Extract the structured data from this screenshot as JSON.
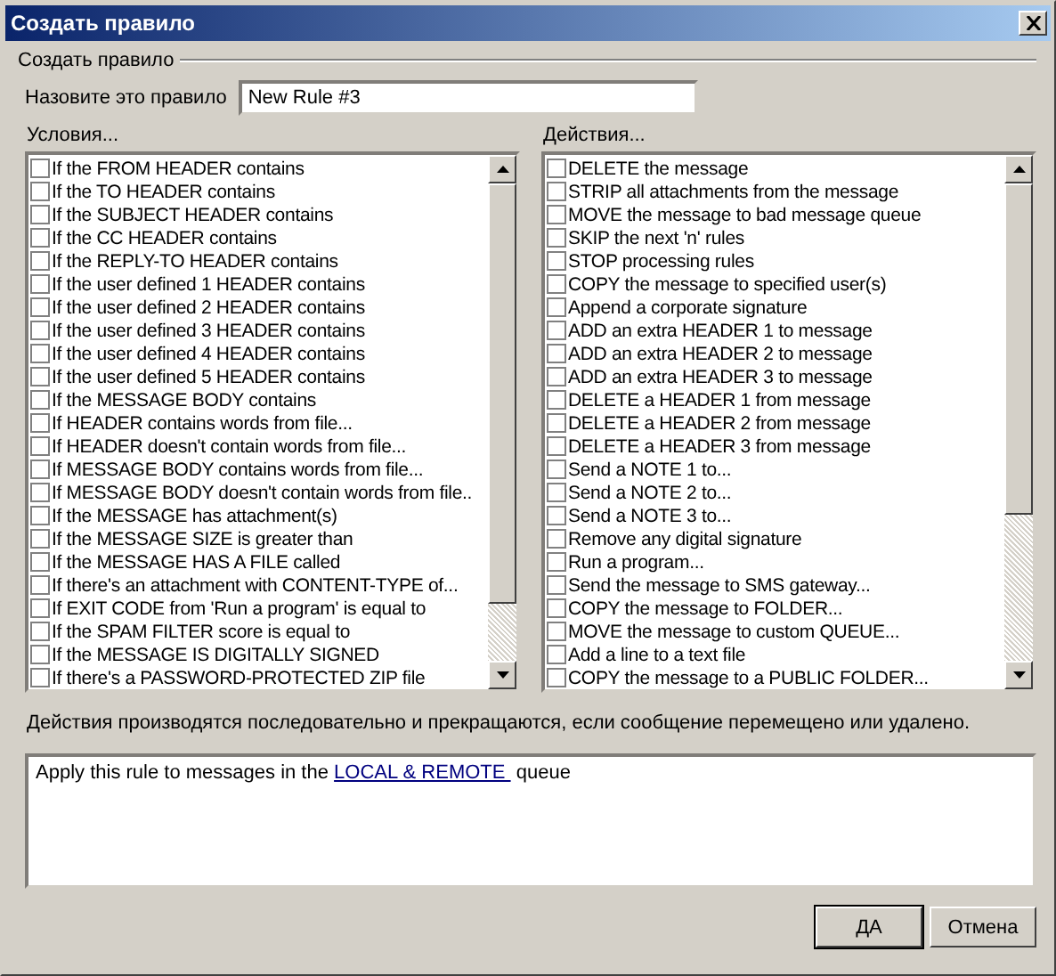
{
  "window": {
    "title": "Создать правило"
  },
  "group": {
    "title": "Создать правило"
  },
  "rule_name": {
    "label": "Назовите это правило",
    "value": "New Rule #3"
  },
  "conditions": {
    "title": "Условия...",
    "items": [
      {
        "label": "If the FROM HEADER contains",
        "checked": false
      },
      {
        "label": "If the TO HEADER contains",
        "checked": false
      },
      {
        "label": "If the SUBJECT HEADER contains",
        "checked": false
      },
      {
        "label": "If the CC HEADER contains",
        "checked": false
      },
      {
        "label": "If the REPLY-TO HEADER contains",
        "checked": false
      },
      {
        "label": "If the user defined 1 HEADER contains",
        "checked": false
      },
      {
        "label": "If the user defined 2 HEADER contains",
        "checked": false
      },
      {
        "label": "If the user defined 3 HEADER contains",
        "checked": false
      },
      {
        "label": "If the user defined 4 HEADER contains",
        "checked": false
      },
      {
        "label": "If the user defined 5 HEADER contains",
        "checked": false
      },
      {
        "label": "If the MESSAGE BODY contains",
        "checked": false
      },
      {
        "label": "If HEADER contains words from file...",
        "checked": false
      },
      {
        "label": "If HEADER doesn't contain words from file...",
        "checked": false
      },
      {
        "label": "If MESSAGE BODY contains words from file...",
        "checked": false
      },
      {
        "label": "If MESSAGE BODY doesn't contain words from file..",
        "checked": false
      },
      {
        "label": "If the MESSAGE has attachment(s)",
        "checked": false
      },
      {
        "label": "If the MESSAGE SIZE is greater than",
        "checked": false
      },
      {
        "label": "If the MESSAGE HAS A FILE called",
        "checked": false
      },
      {
        "label": "If there's an attachment with CONTENT-TYPE of...",
        "checked": false
      },
      {
        "label": "If EXIT CODE from 'Run a program' is equal to",
        "checked": false
      },
      {
        "label": "If the SPAM FILTER score is equal to",
        "checked": false
      },
      {
        "label": "If the MESSAGE IS DIGITALLY SIGNED",
        "checked": false
      },
      {
        "label": "If there's a PASSWORD-PROTECTED ZIP file",
        "checked": false
      }
    ]
  },
  "actions": {
    "title": "Действия...",
    "items": [
      {
        "label": "DELETE the message",
        "checked": false
      },
      {
        "label": "STRIP all attachments from the message",
        "checked": false
      },
      {
        "label": "MOVE the message to bad message queue",
        "checked": false
      },
      {
        "label": "SKIP the next 'n' rules",
        "checked": false
      },
      {
        "label": "STOP processing rules",
        "checked": false
      },
      {
        "label": "COPY the message to specified user(s)",
        "checked": false
      },
      {
        "label": "Append a corporate signature",
        "checked": false
      },
      {
        "label": "ADD an extra HEADER 1 to message",
        "checked": false
      },
      {
        "label": "ADD an extra HEADER 2 to message",
        "checked": false
      },
      {
        "label": "ADD an extra HEADER 3 to message",
        "checked": false
      },
      {
        "label": "DELETE a HEADER 1 from message",
        "checked": false
      },
      {
        "label": "DELETE a HEADER 2 from message",
        "checked": false
      },
      {
        "label": "DELETE a HEADER 3 from message",
        "checked": false
      },
      {
        "label": "Send a NOTE 1 to...",
        "checked": false
      },
      {
        "label": "Send a NOTE 2 to...",
        "checked": false
      },
      {
        "label": "Send a NOTE 3 to...",
        "checked": false
      },
      {
        "label": "Remove any digital signature",
        "checked": false
      },
      {
        "label": "Run a program...",
        "checked": false
      },
      {
        "label": "Send the message to SMS gateway...",
        "checked": false
      },
      {
        "label": "COPY the message to FOLDER...",
        "checked": false
      },
      {
        "label": "MOVE the message to custom QUEUE...",
        "checked": false
      },
      {
        "label": "Add a line to a text file",
        "checked": false
      },
      {
        "label": "COPY the message to a PUBLIC FOLDER...",
        "checked": false
      }
    ]
  },
  "note": "Действия производятся последовательно и прекращаются, если сообщение перемещено или удалено.",
  "description": {
    "before": "Apply this rule to messages in the",
    "link": "LOCAL & REMOTE ",
    "after": "queue"
  },
  "buttons": [
    {
      "label": "ДА",
      "default": true
    },
    {
      "label": "Отмена",
      "default": false
    }
  ]
}
